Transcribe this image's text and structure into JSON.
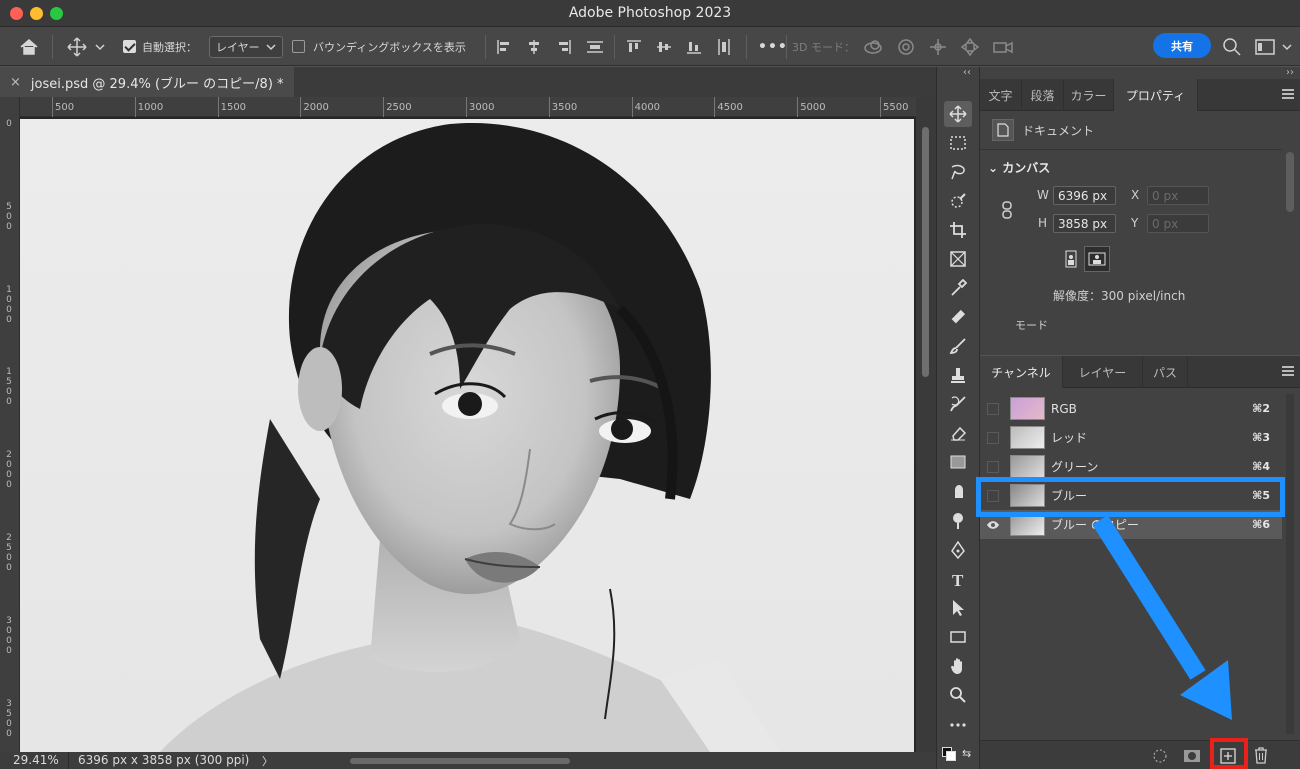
{
  "app": {
    "title": "Adobe Photoshop 2023"
  },
  "options_bar": {
    "auto_select_label": "自動選択：",
    "auto_select_checked": true,
    "layer_dropdown": "レイヤー",
    "bounding_box_label": "バウンディングボックスを表示",
    "bounding_box_checked": false,
    "more": "•••",
    "mode_3d_label": "3D モード：",
    "share_label": "共有"
  },
  "document": {
    "tab_title": "josei.psd @ 29.4% (ブルー のコピー/8) *",
    "close": "×"
  },
  "ruler": {
    "top_labels": [
      "500",
      "1000",
      "1500",
      "2000",
      "2500",
      "3000",
      "3500",
      "4000",
      "4500",
      "5000",
      "5500"
    ],
    "left_labels": [
      "0",
      "500",
      "1000",
      "1500",
      "2000",
      "2500",
      "3000",
      "3500"
    ]
  },
  "status": {
    "zoom": "29.41%",
    "doc_info": "6396 px x 3858 px (300 ppi)",
    "arrow": "〉"
  },
  "toolbar": {
    "tools": [
      "move-tool",
      "marquee-tool",
      "lasso-tool",
      "quick-select-tool",
      "crop-tool",
      "frame-tool",
      "eyedropper-tool",
      "healing-tool",
      "brush-tool",
      "stamp-tool",
      "history-brush-tool",
      "eraser-tool",
      "gradient-tool",
      "smudge-tool",
      "dodge-tool",
      "pen-tool",
      "type-tool",
      "path-select-tool",
      "rectangle-tool",
      "hand-tool",
      "zoom-tool",
      "more-tools"
    ],
    "type_tool_glyph": "T",
    "more_glyph": "•••"
  },
  "properties_panel": {
    "tabs": [
      "文字",
      "段落",
      "カラー",
      "プロパティ"
    ],
    "active_tab": "プロパティ",
    "doc_label": "ドキュメント",
    "canvas_section": "カンバス",
    "w_label": "W",
    "w_value": "6396 px",
    "h_label": "H",
    "h_value": "3858 px",
    "x_label": "X",
    "x_value": "0 px",
    "y_label": "Y",
    "y_value": "0 px",
    "resolution": "解像度：300 pixel/inch",
    "mode_label": "モード"
  },
  "channels_panel": {
    "tabs": [
      "チャンネル",
      "レイヤー",
      "パス"
    ],
    "active_tab": "チャンネル",
    "channels": [
      {
        "name": "RGB",
        "shortcut": "⌘2",
        "visible": false,
        "selected": false
      },
      {
        "name": "レッド",
        "shortcut": "⌘3",
        "visible": false,
        "selected": false
      },
      {
        "name": "グリーン",
        "shortcut": "⌘4",
        "visible": false,
        "selected": false
      },
      {
        "name": "ブルー",
        "shortcut": "⌘5",
        "visible": false,
        "selected": false
      },
      {
        "name": "ブルー のコピー",
        "shortcut": "⌘6",
        "visible": true,
        "selected": true
      }
    ],
    "footer_icons": [
      "load-selection-icon",
      "save-selection-icon",
      "new-channel-icon",
      "trash-icon"
    ]
  },
  "annotations": {
    "highlight_color": "#1e90ff",
    "target_color": "#e8221b"
  }
}
